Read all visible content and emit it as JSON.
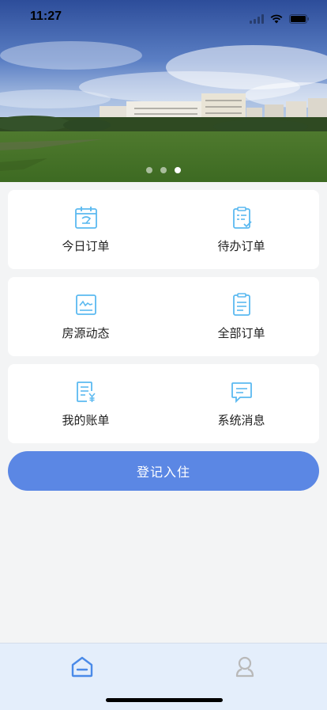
{
  "status_bar": {
    "time": "11:27"
  },
  "banner": {
    "slide_count": 3,
    "active_slide": 3
  },
  "menu_cards": [
    {
      "items": [
        {
          "label": "今日订单",
          "icon": "calendar-icon"
        },
        {
          "label": "待办订单",
          "icon": "todo-clipboard-icon"
        }
      ]
    },
    {
      "items": [
        {
          "label": "房源动态",
          "icon": "chart-line-icon"
        },
        {
          "label": "全部订单",
          "icon": "document-icon"
        }
      ]
    },
    {
      "items": [
        {
          "label": "我的账单",
          "icon": "bill-yen-icon"
        },
        {
          "label": "系统消息",
          "icon": "message-icon"
        }
      ]
    }
  ],
  "checkin_button": {
    "label": "登记入住"
  },
  "tab_bar": {
    "active": "home",
    "items": [
      {
        "icon": "home-icon"
      },
      {
        "icon": "profile-icon"
      }
    ]
  },
  "colors": {
    "primary": "#5b87e4",
    "icon": "#5bb9f0",
    "background": "#f3f4f5"
  }
}
